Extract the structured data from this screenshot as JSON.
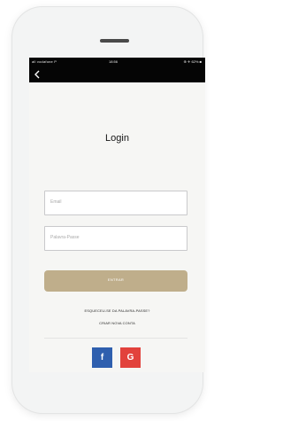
{
  "status_bar": {
    "carrier": "all vodafone P",
    "time": "18:56",
    "battery": "⊕ ✈ 62% ■"
  },
  "login": {
    "title": "Login",
    "email_placeholder": "Email",
    "password_placeholder": "Palavra-Passe",
    "submit_label": "ENTRAR",
    "forgot_link": "ESQUECEU-SE DA PALAVRA-PASSE?",
    "create_account_link": "CRIAR NOVA CONTA"
  },
  "social": {
    "facebook_label": "f",
    "google_label": "G"
  },
  "icons": {
    "back": "chevron-left",
    "facebook": "facebook-icon",
    "google": "google-icon"
  },
  "colors": {
    "status_bar_bg": "#050505",
    "screen_bg": "#f6f6f4",
    "primary_button": "#bfae8b",
    "facebook": "#2f5fae",
    "google": "#e2423c"
  }
}
